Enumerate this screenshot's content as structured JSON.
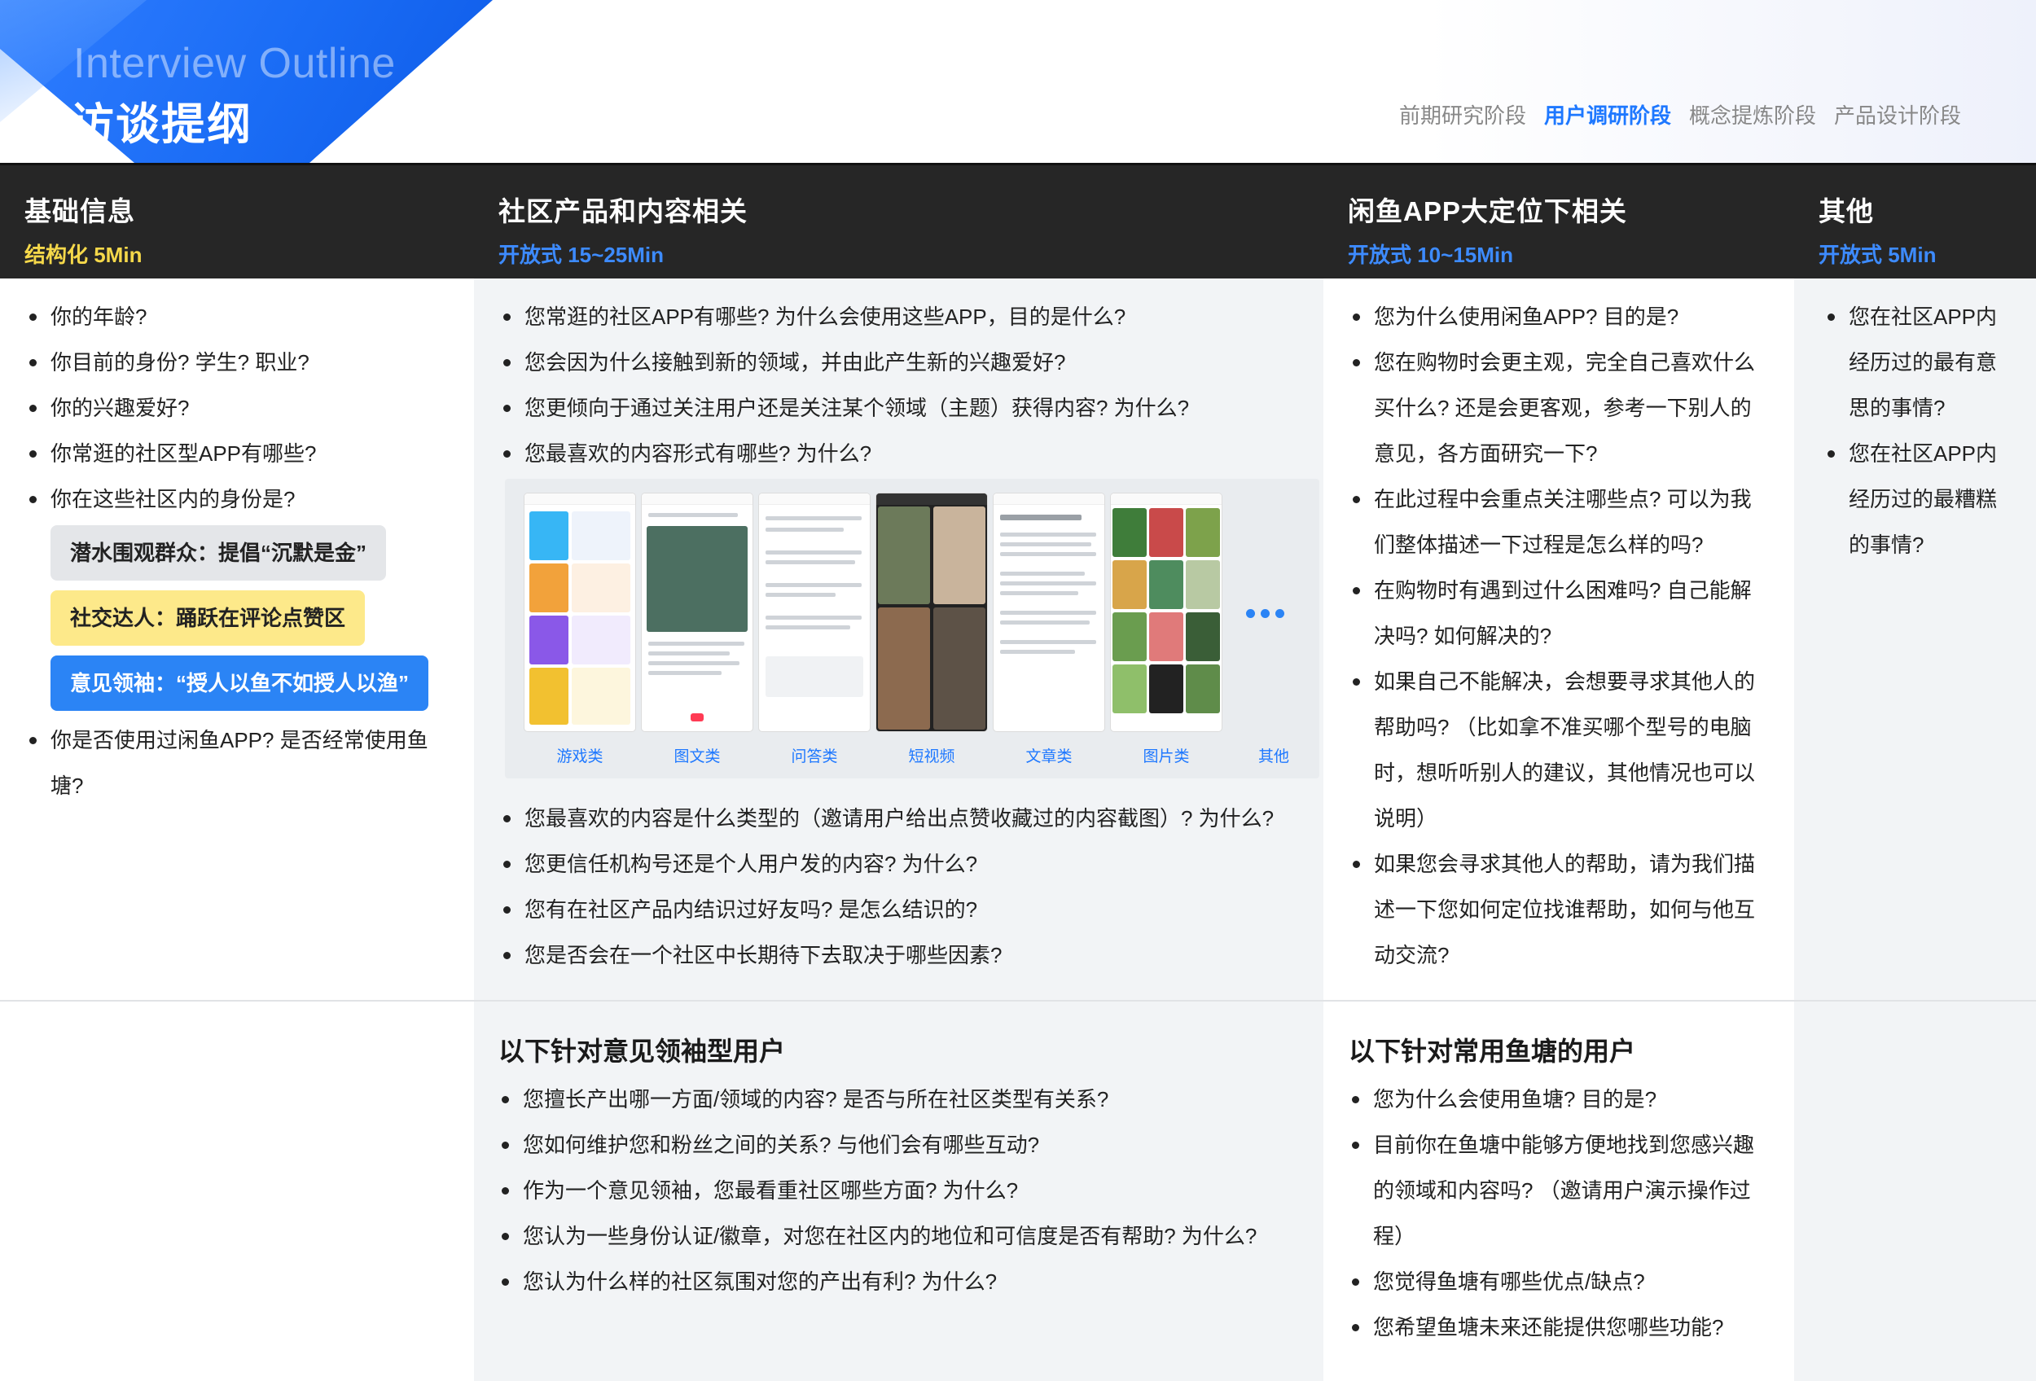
{
  "header": {
    "subtitle": "Interview Outline",
    "title": "访谈提纲",
    "stages": [
      {
        "label": "前期研究阶段",
        "active": false
      },
      {
        "label": "用户调研阶段",
        "active": true
      },
      {
        "label": "概念提炼阶段",
        "active": false
      },
      {
        "label": "产品设计阶段",
        "active": false
      }
    ]
  },
  "columns": [
    {
      "title": "基础信息",
      "sub": "结构化 5Min",
      "sub_color": "#f5d84a"
    },
    {
      "title": "社区产品和内容相关",
      "sub": "开放式 15~25Min",
      "sub_color": "#3d8bff"
    },
    {
      "title": "闲鱼APP大定位下相关",
      "sub": "开放式 10~15Min",
      "sub_color": "#3d8bff"
    },
    {
      "title": "其他",
      "sub": "开放式 5Min",
      "sub_color": "#3d8bff"
    }
  ],
  "basic": {
    "items_a": [
      "你的年龄?",
      "你目前的身份? 学生? 职业?",
      "你的兴趣爱好?",
      "你常逛的社区型APP有哪些?",
      "你在这些社区内的身份是?"
    ],
    "tags": [
      "潜水围观群众：提倡“沉默是金”",
      "社交达人：踊跃在评论点赞区",
      "意见领袖：“授人以鱼不如授人以渔”"
    ],
    "items_b": [
      "你是否使用过闲鱼APP? 是否经常使用鱼",
      "塘?"
    ]
  },
  "community": {
    "items_a": [
      "您常逛的社区APP有哪些? 为什么会使用这些APP，目的是什么?",
      "您会因为什么接触到新的领域，并由此产生新的兴趣爱好?",
      "您更倾向于通过关注用户还是关注某个领域（主题）获得内容? 为什么?",
      "您最喜欢的内容形式有哪些? 为什么?"
    ],
    "screens": [
      "游戏类",
      "图文类",
      "问答类",
      "短视频",
      "文章类",
      "图片类",
      "其他"
    ],
    "items_b": [
      "您最喜欢的内容是什么类型的（邀请用户给出点赞收藏过的内容截图）? 为什么?",
      "您更信任机构号还是个人用户发的内容? 为什么?",
      "您有在社区产品内结识过好友吗? 是怎么结识的?",
      "您是否会在一个社区中长期待下去取决于哪些因素?"
    ],
    "section2_title": "以下针对意见领袖型用户",
    "items_c": [
      "您擅长产出哪一方面/领域的内容? 是否与所在社区类型有关系?",
      "您如何维护您和粉丝之间的关系? 与他们会有哪些互动?",
      "作为一个意见领袖，您最看重社区哪些方面? 为什么?",
      "您认为一些身份认证/徽章，对您在社区内的地位和可信度是否有帮助? 为什么?",
      "您认为什么样的社区氛围对您的产出有利? 为什么?"
    ]
  },
  "xianyu": {
    "items_a": [
      "您为什么使用闲鱼APP? 目的是?",
      "您在购物时会更主观，完全自己喜欢什么",
      "买什么? 还是会更客观，参考一下别人的",
      "意见，各方面研究一下?",
      "在此过程中会重点关注哪些点? 可以为我",
      "们整体描述一下过程是怎么样的吗?",
      "在购物时有遇到过什么困难吗? 自己能解",
      "决吗? 如何解决的?",
      "如果自己不能解决，会想要寻求其他人的",
      "帮助吗? （比如拿不准买哪个型号的电脑",
      "时，想听听别人的建议，其他情况也可以",
      "说明）",
      "如果您会寻求其他人的帮助，请为我们描",
      "述一下您如何定位找谁帮助，如何与他互",
      "动交流?"
    ],
    "section2_title": "以下针对常用鱼塘的用户",
    "items_c": [
      "您为什么会使用鱼塘? 目的是?",
      "目前你在鱼塘中能够方便地找到您感兴趣",
      "的领域和内容吗? （邀请用户演示操作过",
      "程）",
      "您觉得鱼塘有哪些优点/缺点?",
      "您希望鱼塘未来还能提供您哪些功能?"
    ]
  },
  "other": {
    "items_a": [
      "您在社区APP内",
      "经历过的最有意",
      "思的事情?",
      "您在社区APP内",
      "经历过的最糟糕",
      "的事情?"
    ]
  }
}
